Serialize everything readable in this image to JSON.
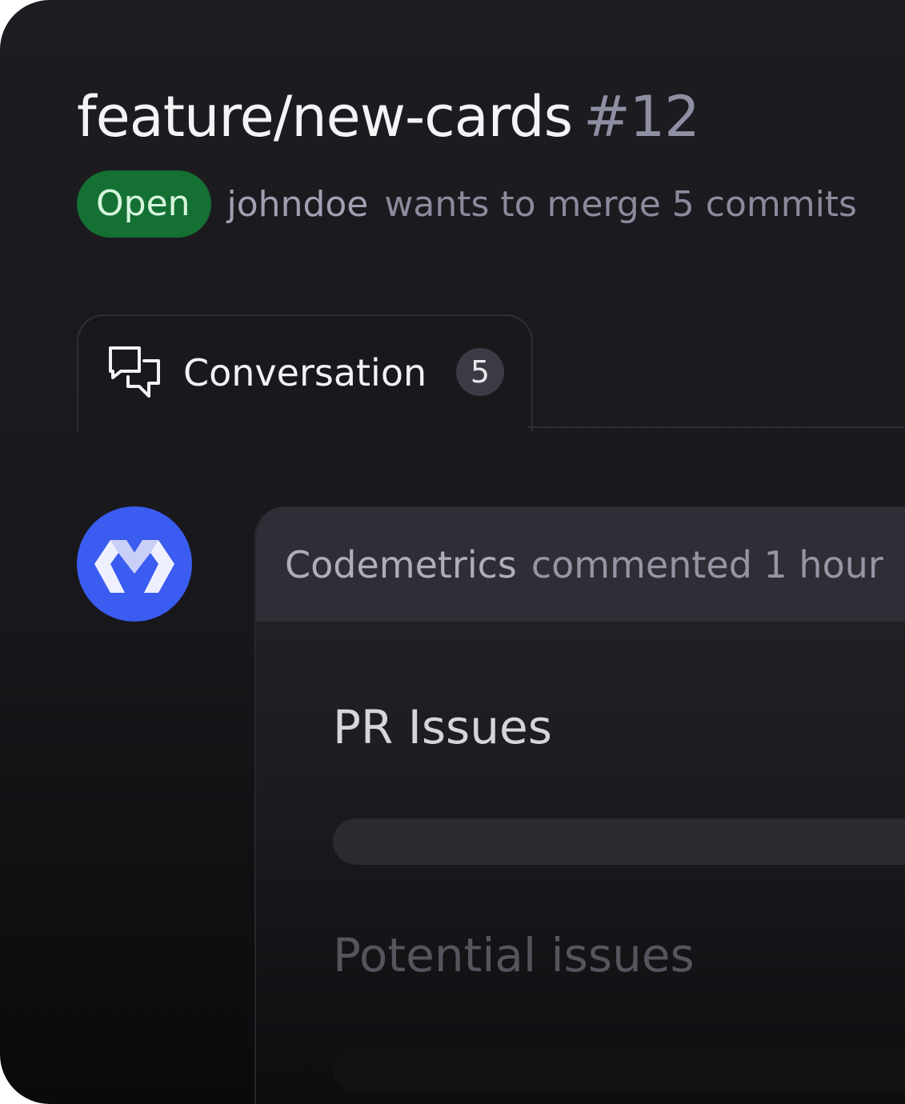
{
  "pr": {
    "branch": "feature/new-cards",
    "number": "#12",
    "status": "Open",
    "author": "johndoe",
    "merge_text": "wants to merge 5 commits"
  },
  "tabs": [
    {
      "label": "Conversation",
      "count": "5",
      "icon": "conversation-icon",
      "active": true
    }
  ],
  "comment": {
    "avatar_icon": "codemetrics-logo",
    "commenter": "Codemetrics",
    "action": "commented 1 hour",
    "sections": [
      {
        "title": "PR Issues"
      },
      {
        "title": "Potential issues"
      }
    ]
  },
  "colors": {
    "open_badge": "#157033",
    "avatar_bg": "#3a5cf0",
    "background": "#1c1c21"
  }
}
